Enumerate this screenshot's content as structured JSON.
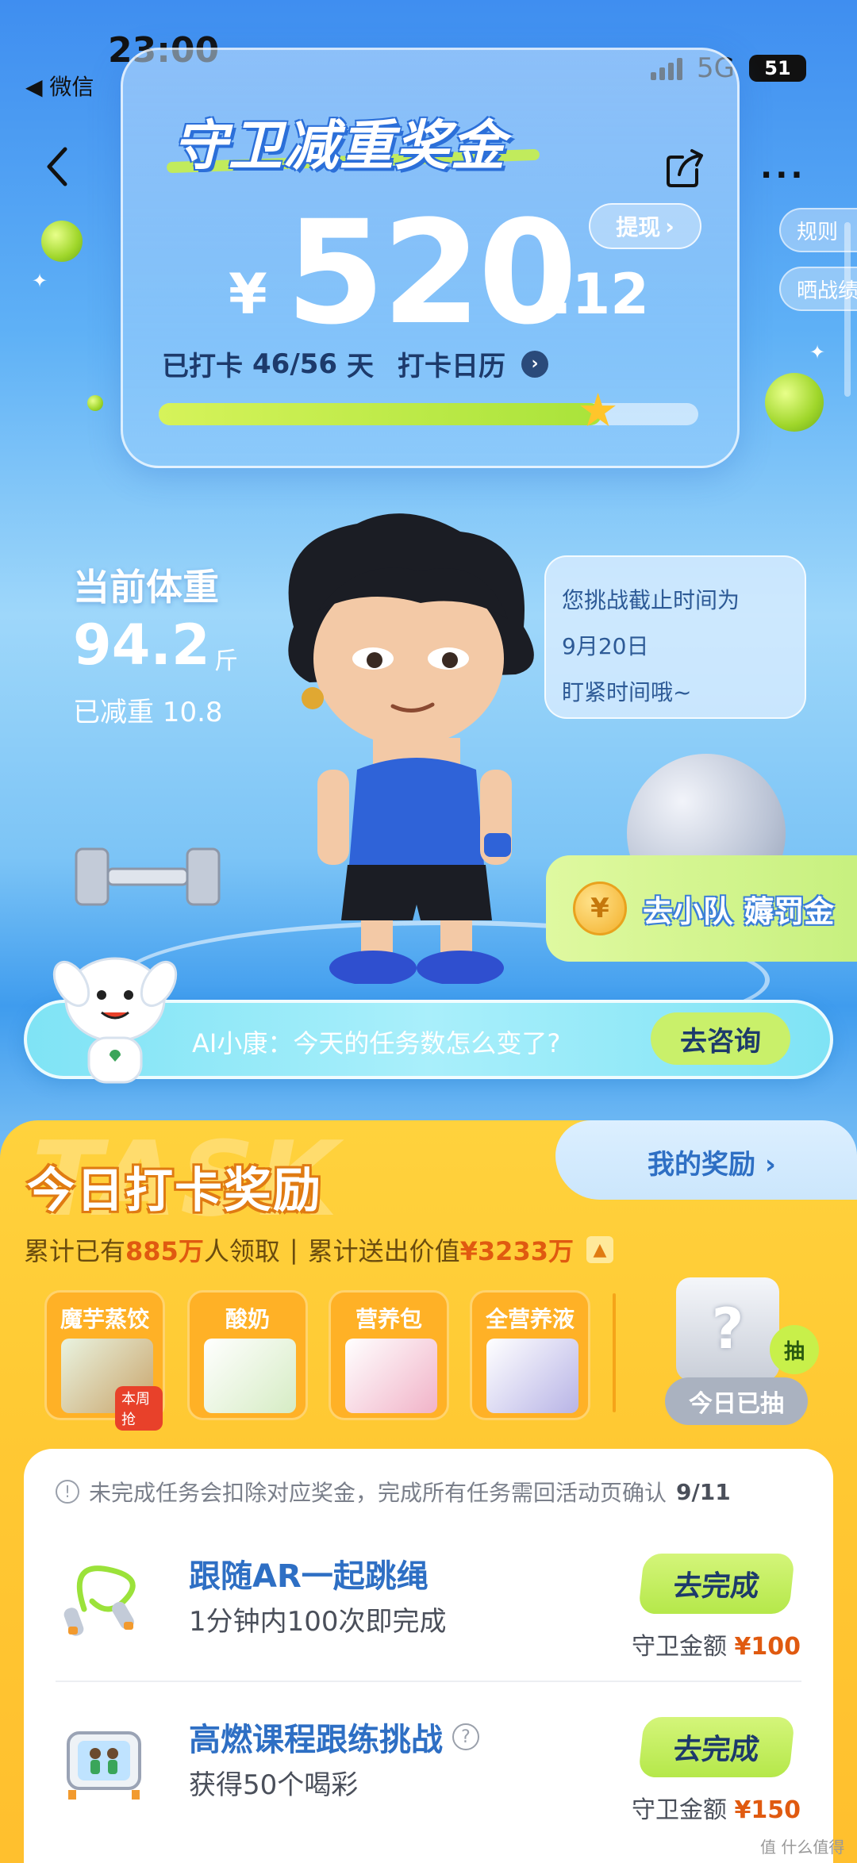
{
  "status_bar": {
    "time": "23:00",
    "back_app": "◀ 微信",
    "network": "5G",
    "battery": "51"
  },
  "header": {
    "more": "···"
  },
  "prize": {
    "title": "守卫减重奖金",
    "currency": "¥",
    "amount_main": "520",
    "amount_cents": ".12",
    "withdraw_label": "提现",
    "checkin_prefix": "已打卡",
    "checkin_count": "46/56",
    "checkin_unit": "天",
    "calendar_label": "打卡日历",
    "progress_fraction": 0.82
  },
  "side_links": {
    "rules": "规则",
    "share_record": "晒战绩"
  },
  "weight": {
    "label": "当前体重",
    "value": "94.2",
    "unit": "斤",
    "lost": "已减重 10.8"
  },
  "deadline": {
    "line1": "您挑战截止时间为",
    "line2": "9月20日",
    "line3": "盯紧时间哦~"
  },
  "team": {
    "label": "去小队 薅罚金",
    "coin": "¥"
  },
  "ai": {
    "prompt": "AI小康：今天的任务数怎么变了?",
    "button": "去咨询"
  },
  "reward": {
    "watermark": "TASK",
    "title": "今日打卡奖励",
    "my_reward": "我的奖励",
    "stats": {
      "prefix": "累计已有",
      "people": "885万",
      "people_suffix": "人领取",
      "sep": "|",
      "value_prefix": "累计送出价值",
      "value": "¥3233万"
    },
    "items": [
      {
        "name": "魔芋蒸饺",
        "tag": "本周抢"
      },
      {
        "name": "酸奶"
      },
      {
        "name": "营养包"
      },
      {
        "name": "全营养液"
      }
    ],
    "draw_badge": "抽",
    "draw_status": "今日已抽"
  },
  "tasks": {
    "notice": "未完成任务会扣除对应奖金，完成所有任务需回活动页确认",
    "notice_count": "9/11",
    "reward_label": "守卫金额",
    "items": [
      {
        "title": "跟随AR一起跳绳",
        "desc": "1分钟内100次即完成",
        "button": "去完成",
        "amount": "¥100"
      },
      {
        "title": "高燃课程跟练挑战",
        "desc": "获得50个喝彩",
        "button": "去完成",
        "amount": "¥150"
      }
    ]
  },
  "corner_mark": "值 什么值得买",
  "colors": {
    "accent_blue": "#2e6fc4",
    "reward_yellow": "#ffc933",
    "highlight_orange": "#e05a10",
    "button_green": "#b5e84a"
  }
}
